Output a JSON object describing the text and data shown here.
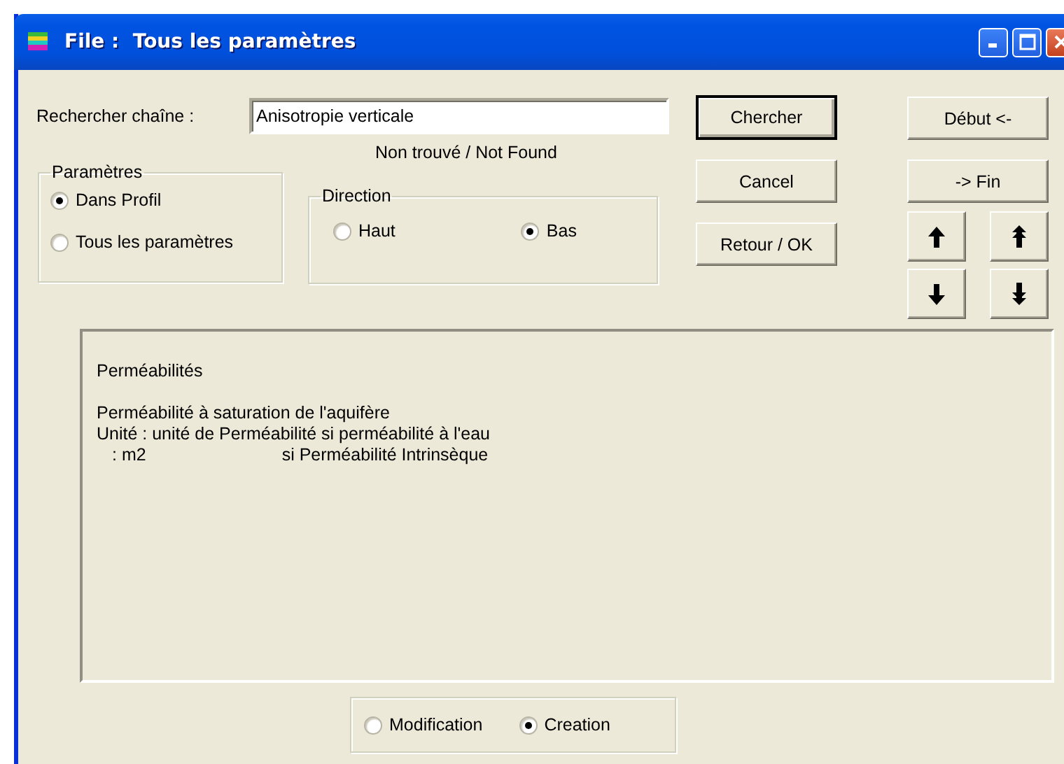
{
  "window": {
    "title": "File :  Tous les paramètres"
  },
  "search": {
    "label": "Rechercher chaîne :",
    "value": "Anisotropie verticale",
    "status": "Non trouvé / Not Found"
  },
  "groups": [
    {
      "title": "Paramètres",
      "options": [
        {
          "label": "Dans Profil",
          "selected": true
        },
        {
          "label": "Tous les paramètres",
          "selected": false
        }
      ]
    },
    {
      "title": "Direction",
      "options": [
        {
          "label": "Haut",
          "selected": false
        },
        {
          "label": "Bas",
          "selected": true
        }
      ]
    }
  ],
  "buttons": [
    {
      "label": "Chercher",
      "default": true
    },
    {
      "label": "Cancel",
      "default": false
    },
    {
      "label": "Retour / OK",
      "default": false
    }
  ],
  "nav_buttons": [
    "Début <-",
    "-> Fin"
  ],
  "description": {
    "paragraphs": [
      [
        "Perméabilités"
      ],
      [
        "Perméabilité à saturation de l'aquifère",
        "Unité : unité de Perméabilité si perméabilité à l'eau"
      ]
    ],
    "unit_line": {
      "unit": ": m2",
      "note": "si Perméabilité Intrinsèque"
    }
  },
  "mode": {
    "options": [
      {
        "label": "Modification",
        "selected": false
      },
      {
        "label": "Creation",
        "selected": true
      }
    ]
  }
}
